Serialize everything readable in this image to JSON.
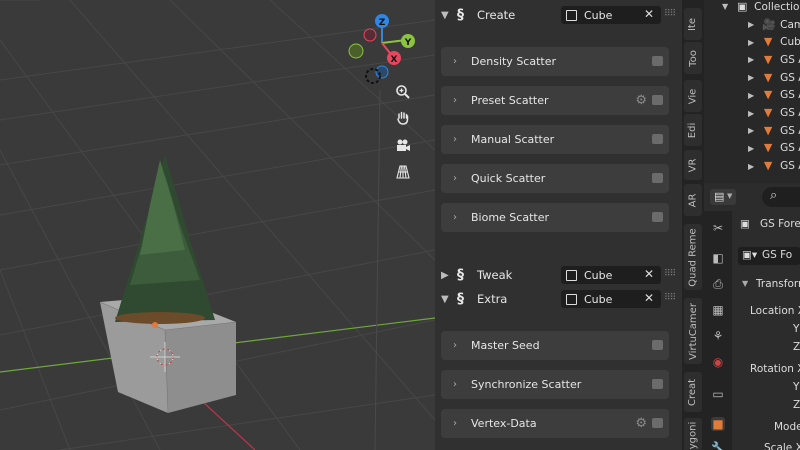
{
  "viewport": {
    "gizmo": {
      "z_label": "Z",
      "y_label": "Y",
      "x_label": "X"
    },
    "nav_buttons": [
      "zoom-icon",
      "hand-pan-icon",
      "camera-icon",
      "grid-perspective-icon"
    ]
  },
  "npanel": {
    "create": {
      "label": "Create",
      "object": "Cube",
      "clear": "✕"
    },
    "create_panels": [
      {
        "label": "Density Scatter",
        "has_gear": false
      },
      {
        "label": "Preset Scatter",
        "has_gear": true
      },
      {
        "label": "Manual Scatter",
        "has_gear": false
      },
      {
        "label": "Quick Scatter",
        "has_gear": false
      },
      {
        "label": "Biome Scatter",
        "has_gear": false
      }
    ],
    "tweak": {
      "label": "Tweak",
      "object": "Cube",
      "clear": "✕"
    },
    "extra": {
      "label": "Extra",
      "object": "Cube",
      "clear": "✕"
    },
    "extra_panels": [
      {
        "label": "Master Seed",
        "has_gear": false
      },
      {
        "label": "Synchronize Scatter",
        "has_gear": false
      },
      {
        "label": "Vertex-Data",
        "has_gear": true
      }
    ]
  },
  "tabs": [
    "Ite",
    "Too",
    "Vie",
    "Edi",
    "VR",
    "AR",
    "Quad Reme",
    "VirtuCamer",
    "Creat",
    "ygoni"
  ],
  "outliner": {
    "collection": "Collectio",
    "items": [
      {
        "label": "Cam",
        "icon": "camera-object-icon"
      },
      {
        "label": "Cube",
        "icon": "mesh-icon"
      },
      {
        "label": "GS A",
        "icon": "mesh-icon"
      },
      {
        "label": "GS A",
        "icon": "mesh-icon"
      },
      {
        "label": "GS A",
        "icon": "mesh-icon"
      },
      {
        "label": "GS A",
        "icon": "mesh-icon"
      },
      {
        "label": "GS A",
        "icon": "mesh-icon"
      },
      {
        "label": "GS A",
        "icon": "mesh-icon"
      },
      {
        "label": "GS A",
        "icon": "mesh-icon"
      }
    ]
  },
  "properties": {
    "search_icon": "search-icon",
    "object_name": "GS Fores",
    "object_name2": "GS Fo",
    "transform_label": "Transforn",
    "location_x": "Location X",
    "y": "Y",
    "z": "Z",
    "rotation_x": "Rotation X",
    "mode": "Mode",
    "scale_x": "Scale X"
  },
  "colors": {
    "axis_x": "#e8465e",
    "axis_y": "#8bc43f",
    "axis_z": "#2f86e3",
    "accent_orange": "#e07b39"
  }
}
